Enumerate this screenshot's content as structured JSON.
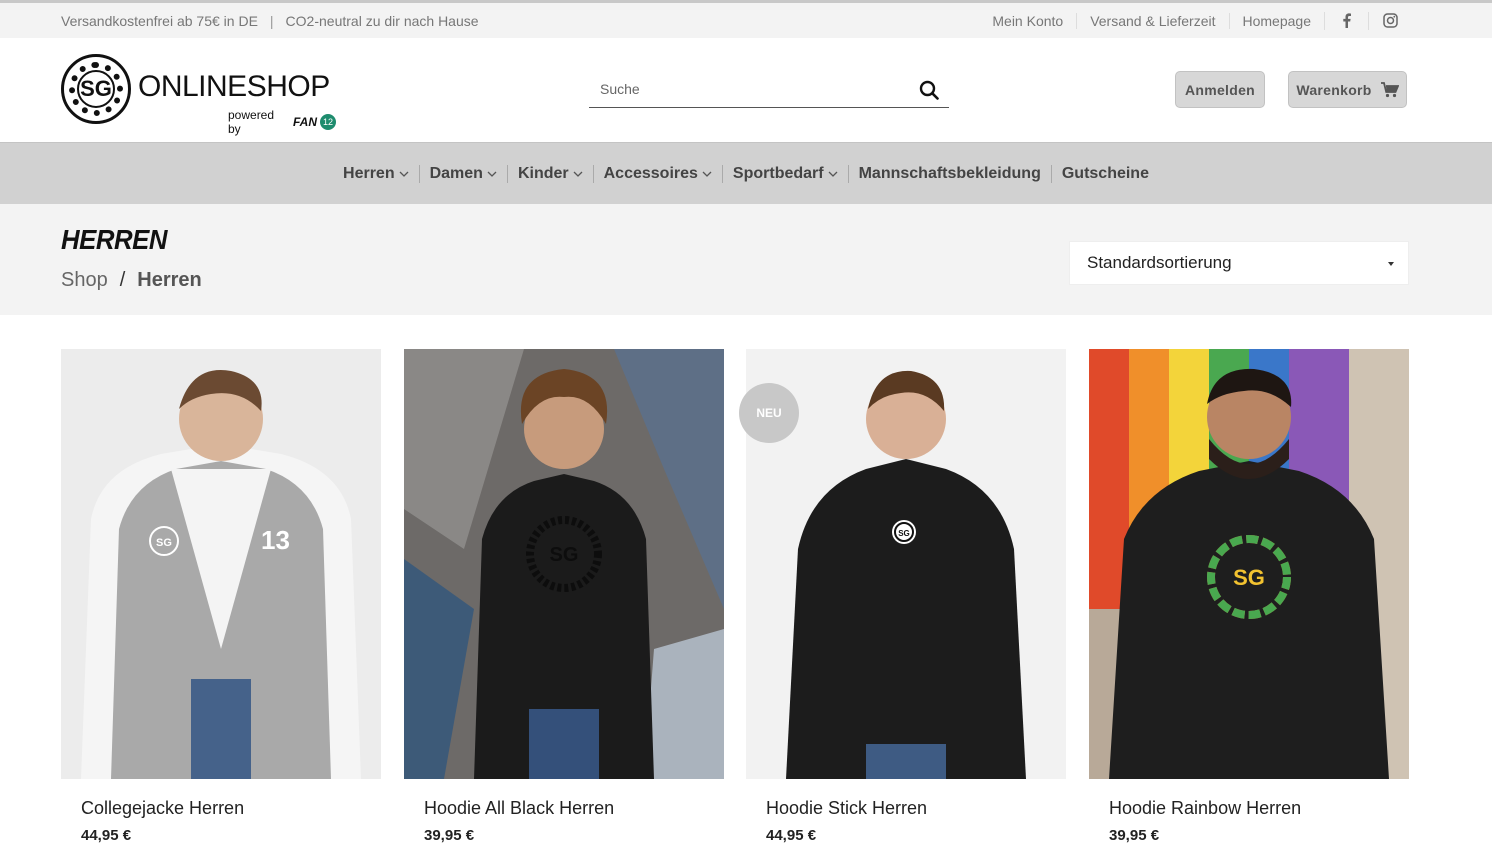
{
  "topbar": {
    "promo_1": "Versandkostenfrei ab 75€ in DE",
    "divider": "|",
    "promo_2": "CO2-neutral zu dir nach Hause",
    "links": [
      "Mein Konto",
      "Versand & Lieferzeit",
      "Homepage"
    ]
  },
  "logo": {
    "badge_text": "SG",
    "title": "ONLINESHOP",
    "powered_by": "powered by",
    "brand": "FAN",
    "brand_mark": "12"
  },
  "search": {
    "placeholder": "Suche"
  },
  "header": {
    "login_label": "Anmelden",
    "cart_label": "Warenkorb"
  },
  "nav": {
    "items": [
      {
        "label": "Herren",
        "has_dropdown": true
      },
      {
        "label": "Damen",
        "has_dropdown": true
      },
      {
        "label": "Kinder",
        "has_dropdown": true
      },
      {
        "label": "Accessoires",
        "has_dropdown": true
      },
      {
        "label": "Sportbedarf",
        "has_dropdown": true
      },
      {
        "label": "Mannschaftsbekleidung",
        "has_dropdown": false
      },
      {
        "label": "Gutscheine",
        "has_dropdown": false
      }
    ]
  },
  "page": {
    "title": "HERREN",
    "breadcrumb": {
      "shop": "Shop",
      "separator": "/",
      "current": "Herren"
    },
    "sort_selected": "Standardsortierung"
  },
  "products": [
    {
      "name": "Collegejacke Herren",
      "price": "44,95 €",
      "badge": ""
    },
    {
      "name": "Hoodie All Black Herren",
      "price": "39,95 €",
      "badge": ""
    },
    {
      "name": "Hoodie Stick Herren",
      "price": "44,95 €",
      "badge": "NEU"
    },
    {
      "name": "Hoodie Rainbow Herren",
      "price": "39,95 €",
      "badge": ""
    }
  ],
  "colors": {
    "topbar_bg": "#f3f3f3",
    "nav_bg": "#d1d1d1",
    "button_bg": "#d7d7d7",
    "text_dark": "#222222"
  },
  "icons": [
    "facebook-icon",
    "instagram-icon",
    "search-icon",
    "cart-icon",
    "chevron-down-icon",
    "caret-down-icon"
  ]
}
